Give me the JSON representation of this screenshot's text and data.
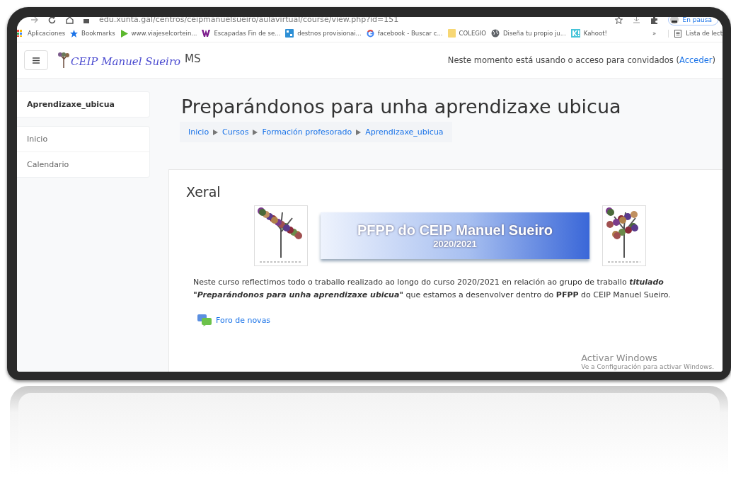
{
  "browser": {
    "address": "edu.xunta.gal/centros/ceipmanuelsueiro/aulavirtual/course/view.php?id=151",
    "bookmarks": [
      {
        "label": "Aplicaciones",
        "kind": "apps"
      },
      {
        "label": "Bookmarks",
        "kind": "star"
      },
      {
        "label": "www.viajeselcortein...",
        "kind": "play"
      },
      {
        "label": "Escapadas Fin de se...",
        "kind": "w"
      },
      {
        "label": "destnos provisionai...",
        "kind": "tile"
      },
      {
        "label": "facebook - Buscar c...",
        "kind": "google"
      },
      {
        "label": "COLEGIO",
        "kind": "folder"
      },
      {
        "label": "Diseña tu propio ju...",
        "kind": "globe"
      },
      {
        "label": "Kahoot!",
        "kind": "kahoot"
      }
    ],
    "more": "»",
    "reading_list": "Lista de lect",
    "profile": "En pausa"
  },
  "header": {
    "site_name": "CEIP Manuel Sueiro",
    "initials": "MS",
    "notice": "Neste momento está usando o acceso para convidados (",
    "login_link": "Acceder",
    "notice_end": ")"
  },
  "sidebar": {
    "course": "Aprendizaxe_ubicua",
    "items": [
      {
        "label": "Inicio"
      },
      {
        "label": "Calendario"
      }
    ]
  },
  "page": {
    "title": "Preparándonos para unha aprendizaxe ubicua",
    "breadcrumb": [
      "Inicio",
      "Cursos",
      "Formación profesorado",
      "Aprendizaxe_ubicua"
    ],
    "section": {
      "title": "Xeral",
      "banner": {
        "title": "PFPP do CEIP Manuel Sueiro",
        "year": "2020/2021"
      },
      "summary": "Neste curso reflectimos todo o traballo realizado ao longo do curso 2020/2021 en relación ao grupo de traballo **titulado** **\"Preparándonos para unha aprendizaxe ubicua\"** que estamos a desenvolver dentro do **PFPP** do CEIP Manuel Sueiro.",
      "activities": [
        {
          "label": "Foro de novas",
          "kind": "forum"
        }
      ]
    }
  },
  "activation": {
    "title": "Activar Windows",
    "subtitle": "Ve a Configuración para activar Windows."
  }
}
